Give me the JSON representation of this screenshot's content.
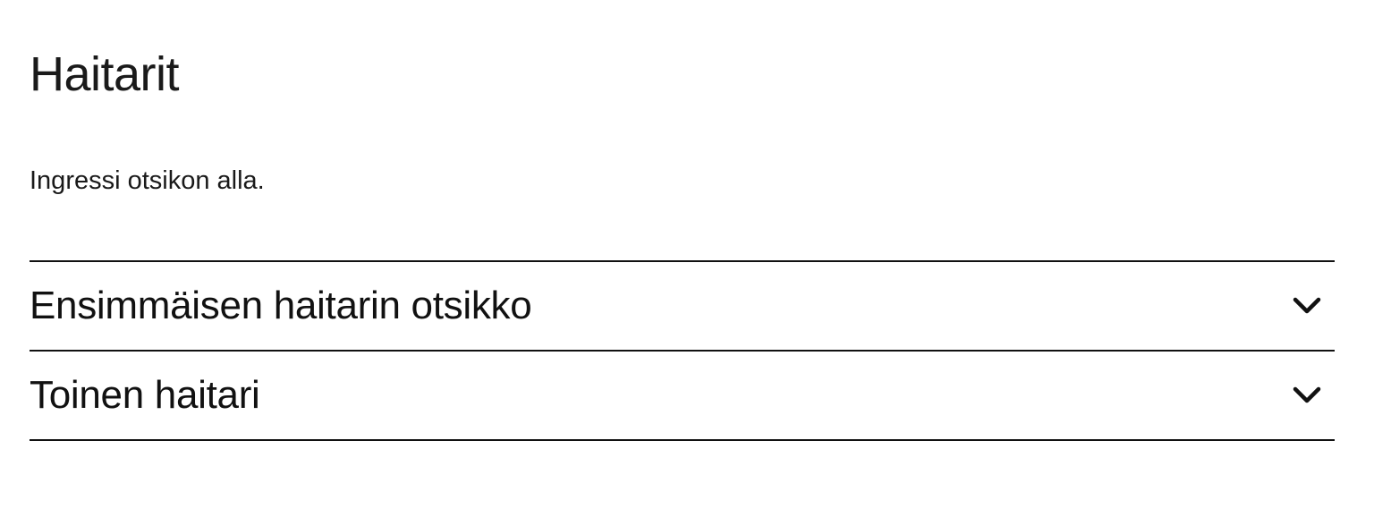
{
  "page": {
    "title": "Haitarit",
    "lead": "Ingressi otsikon alla."
  },
  "accordion": {
    "items": [
      {
        "title": "Ensimmäisen haitarin otsikko",
        "icon": "chevron-down-icon",
        "expanded": false
      },
      {
        "title": "Toinen haitari",
        "icon": "chevron-down-icon",
        "expanded": false
      }
    ]
  },
  "colors": {
    "text": "#1a1a1a",
    "divider": "#111111",
    "background": "#ffffff"
  }
}
